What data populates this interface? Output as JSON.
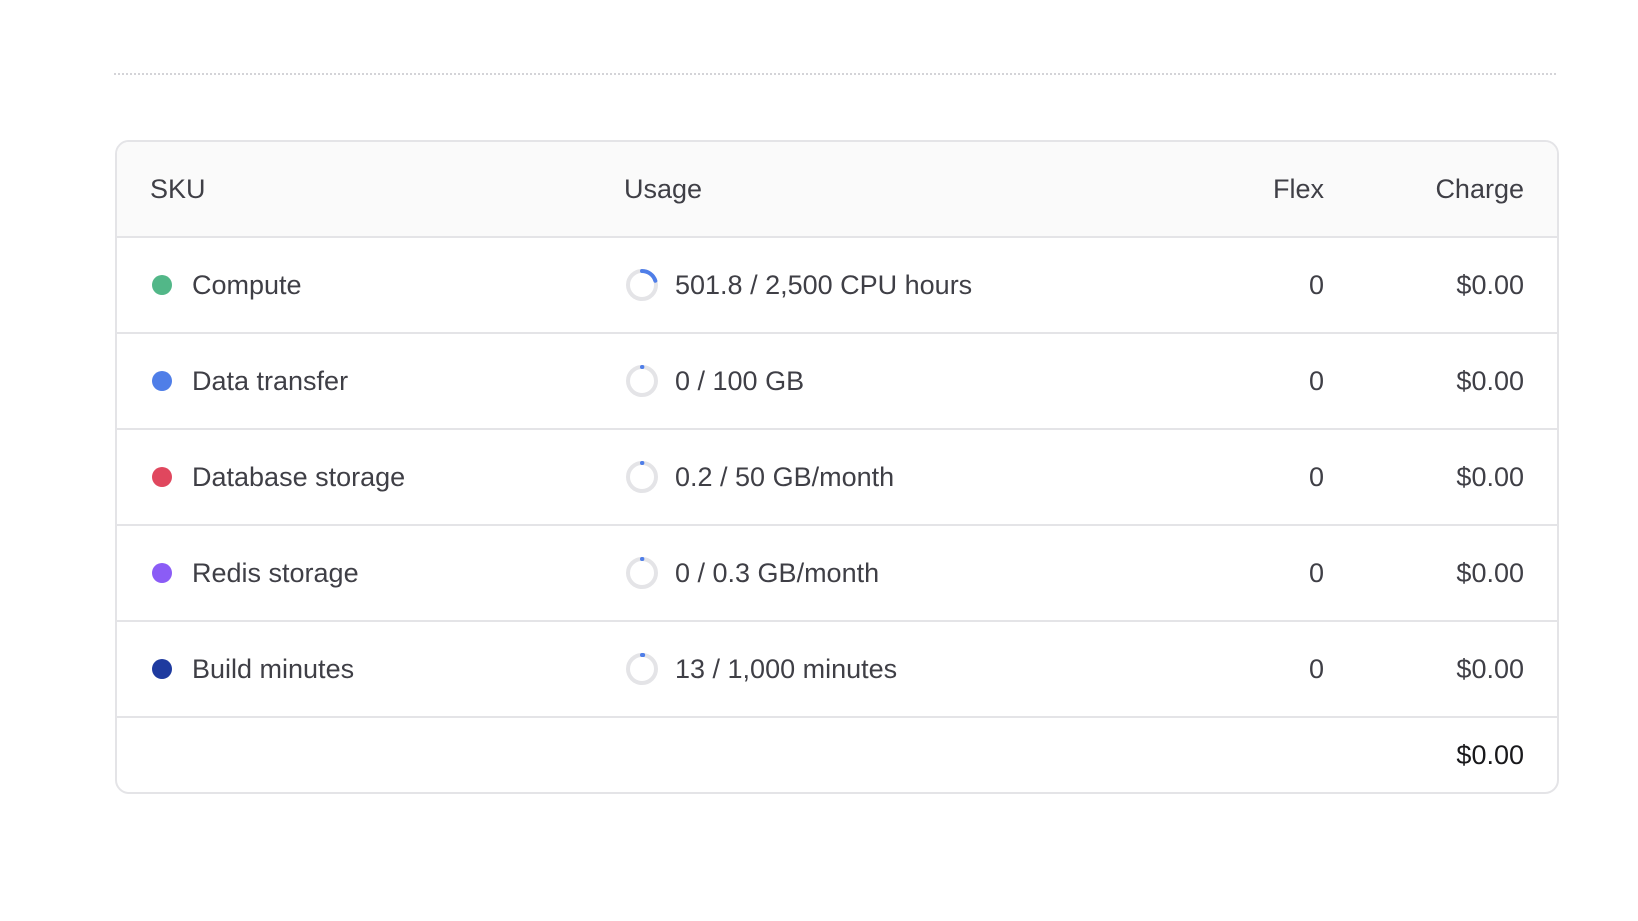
{
  "table": {
    "headers": {
      "sku": "SKU",
      "usage": "Usage",
      "flex": "Flex",
      "charge": "Charge"
    },
    "rows": [
      {
        "sku": "Compute",
        "dot_color": "#52b788",
        "usage": "501.8 / 2,500 CPU hours",
        "usage_fraction": 0.2007,
        "flex": "0",
        "charge": "$0.00"
      },
      {
        "sku": "Data transfer",
        "dot_color": "#4f7ee8",
        "usage": "0 / 100 GB",
        "usage_fraction": 0,
        "flex": "0",
        "charge": "$0.00"
      },
      {
        "sku": "Database storage",
        "dot_color": "#e0475e",
        "usage": "0.2 / 50 GB/month",
        "usage_fraction": 0.004,
        "flex": "0",
        "charge": "$0.00"
      },
      {
        "sku": "Redis storage",
        "dot_color": "#8b5cf6",
        "usage": "0 / 0.3 GB/month",
        "usage_fraction": 0,
        "flex": "0",
        "charge": "$0.00"
      },
      {
        "sku": "Build minutes",
        "dot_color": "#1e3a9f",
        "usage": "13 / 1,000 minutes",
        "usage_fraction": 0.013,
        "flex": "0",
        "charge": "$0.00"
      }
    ],
    "total": "$0.00"
  },
  "colors": {
    "progress_accent": "#4f7ee8",
    "progress_track": "#e4e4e7"
  }
}
